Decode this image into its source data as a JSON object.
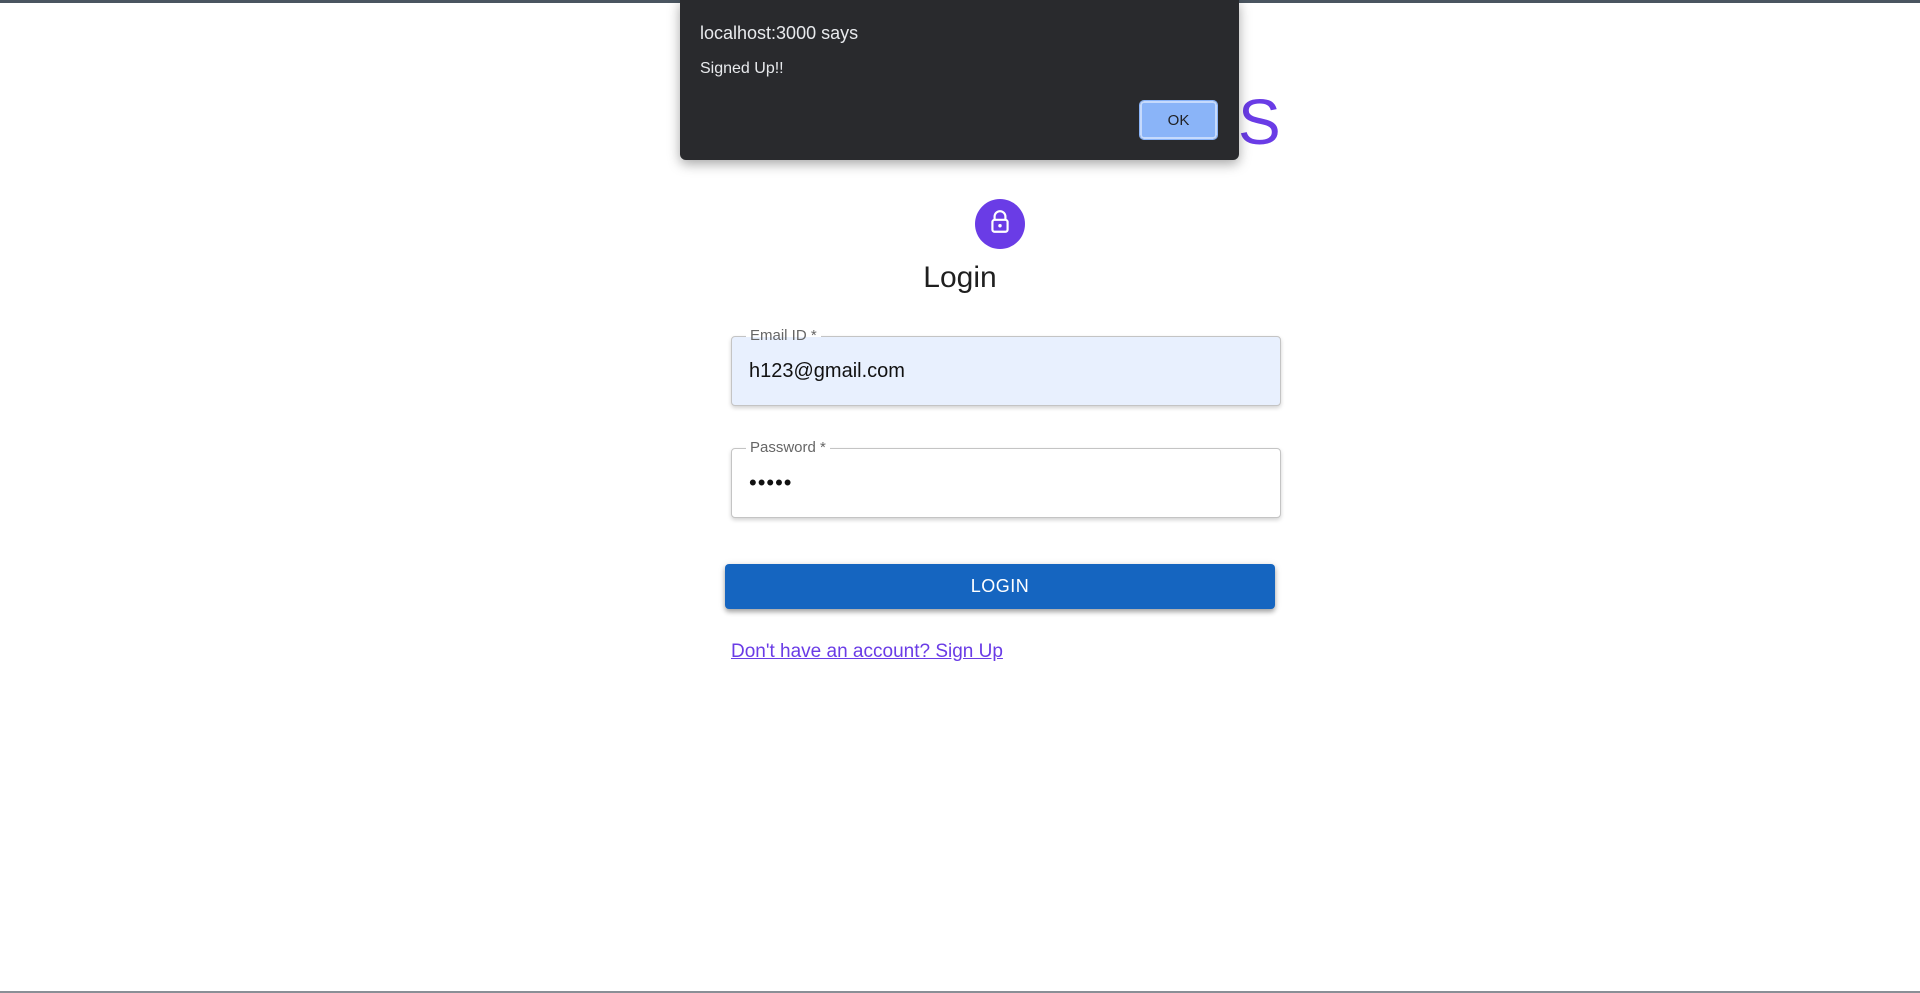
{
  "app": {
    "title": "S"
  },
  "login": {
    "heading": "Login",
    "email_label": "Email ID  *",
    "email_value": "h123@gmail.com",
    "password_label": "Password  *",
    "password_value": "•••••",
    "button_label": "LOGIN",
    "signup_link": "Don't have an account? Sign Up"
  },
  "alert": {
    "title": "localhost:3000 says",
    "message": "Signed Up!!",
    "ok_label": "OK"
  },
  "icons": {
    "avatar": "lock-icon"
  },
  "colors": {
    "accent": "#6a3ce6",
    "primary_button": "#1565c0",
    "alert_background": "#292a2d",
    "alert_button": "#8ab4f8",
    "autofill_background": "#e8f0fe"
  }
}
